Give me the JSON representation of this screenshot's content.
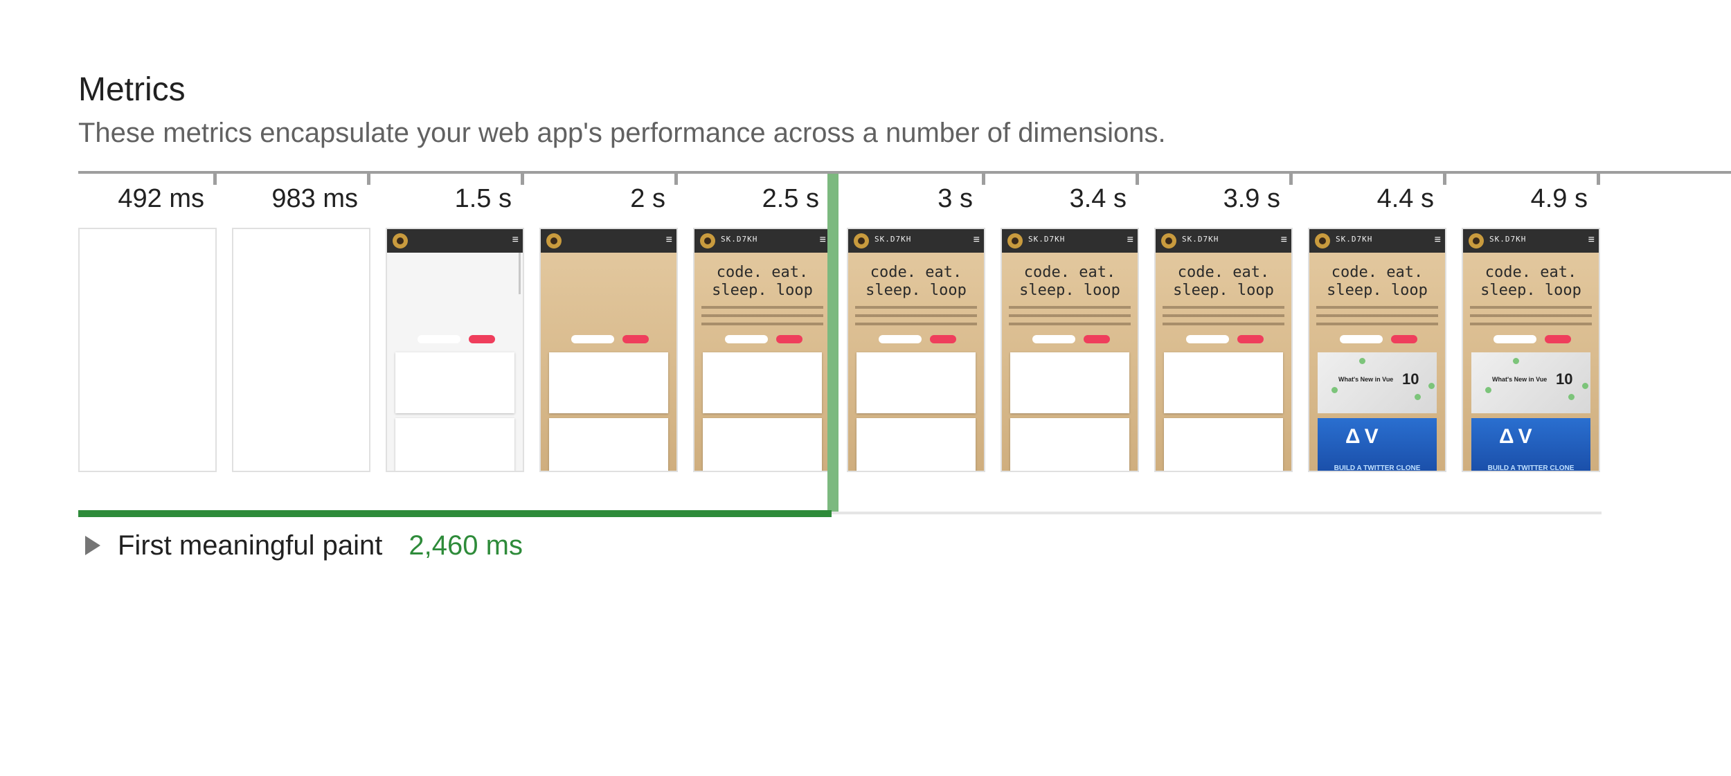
{
  "section": {
    "title": "Metrics",
    "description": "These metrics encapsulate your web app's performance across a number of dimensions."
  },
  "filmstrip": [
    {
      "time": "492 ms",
      "state": "blank"
    },
    {
      "time": "983 ms",
      "state": "blank"
    },
    {
      "time": "1.5 s",
      "state": "loading"
    },
    {
      "time": "2 s",
      "state": "background"
    },
    {
      "time": "2.5 s",
      "state": "hero"
    },
    {
      "time": "3 s",
      "state": "hero"
    },
    {
      "time": "3.4 s",
      "state": "hero"
    },
    {
      "time": "3.9 s",
      "state": "hero"
    },
    {
      "time": "4.4 s",
      "state": "full"
    },
    {
      "time": "4.9 s",
      "state": "full"
    }
  ],
  "thumbnail": {
    "brand": "SK.D7KH",
    "hero_line1": "code. eat.",
    "hero_line2": "sleep. loop",
    "card_text": "What's New in Vue",
    "card_number": "10",
    "banner_text": "BUILD A TWITTER CLONE",
    "menu_icon": "hamburger-icon"
  },
  "metric": {
    "label": "First meaningful paint",
    "value": "2,460 ms",
    "value_ms": 2460,
    "color": "#2e8b3a",
    "expand_icon": "triangle-right-icon"
  }
}
